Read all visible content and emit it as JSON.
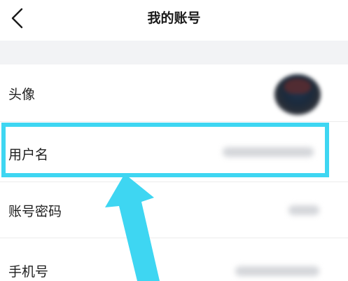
{
  "header": {
    "title": "我的账号",
    "back_icon": "chevron-left-icon"
  },
  "rows": [
    {
      "label": "头像"
    },
    {
      "label": "用户名"
    },
    {
      "label": "账号密码"
    },
    {
      "label": "手机号"
    }
  ],
  "annotation": {
    "highlight_color": "#3ed6f2",
    "arrow_color": "#3ed6f2",
    "highlighted_row": "用户名"
  }
}
